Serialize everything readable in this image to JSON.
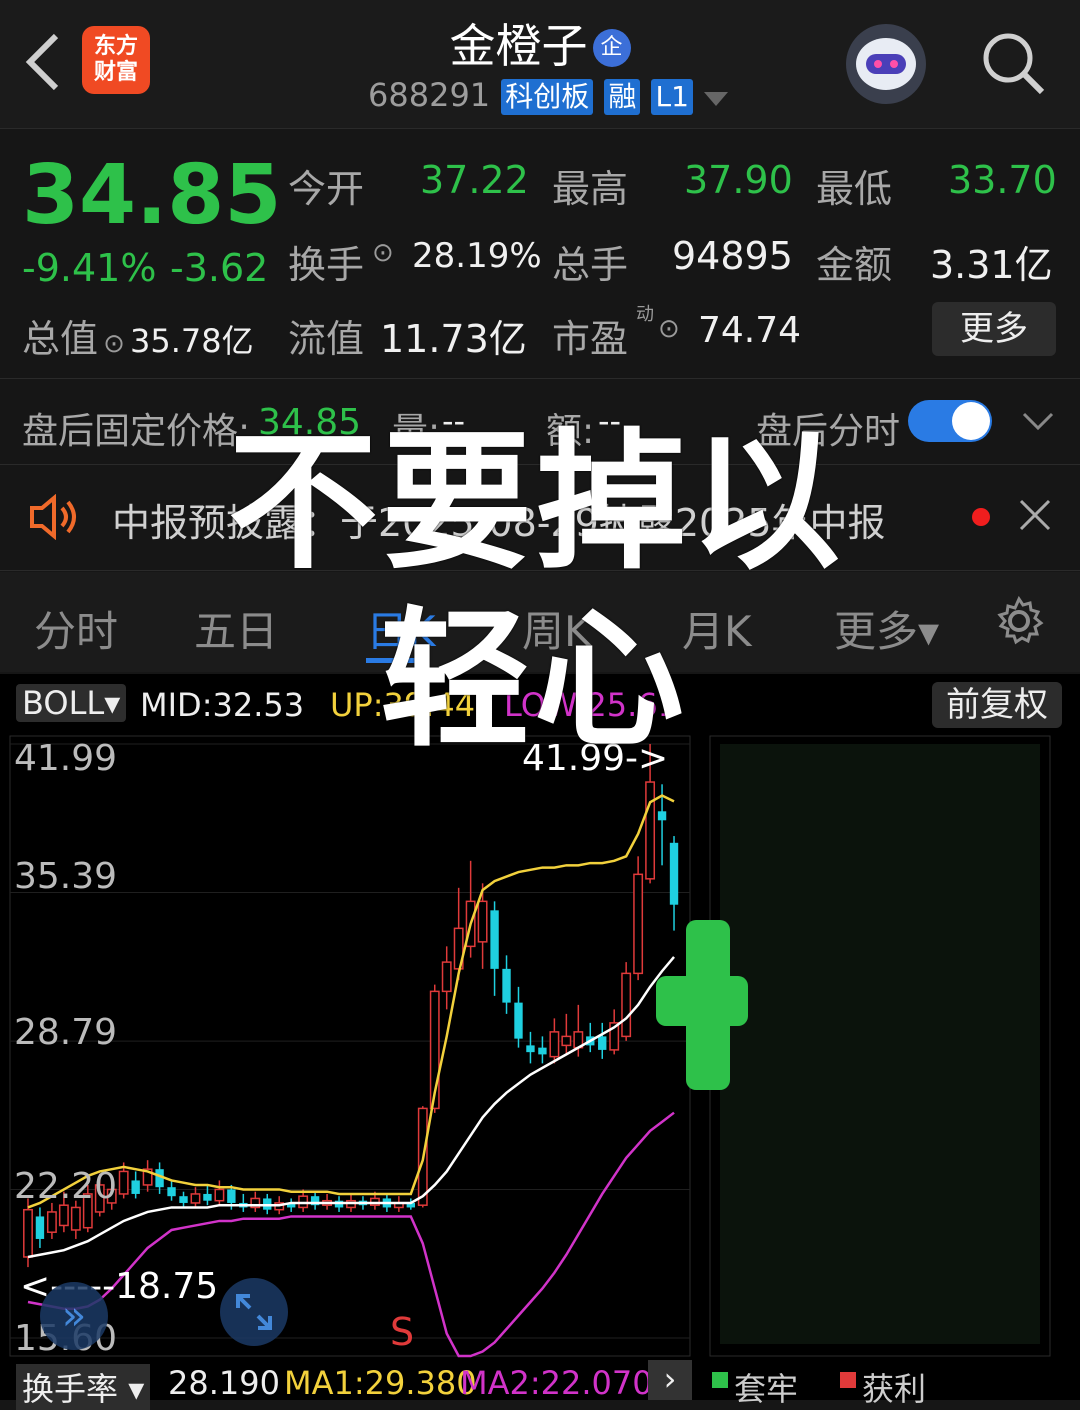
{
  "header": {
    "back_icon": "chevron-left-icon",
    "logo_text": "东方财富",
    "stock_name": "金橙子",
    "enterprise_badge": "企",
    "stock_code": "688291",
    "tags": [
      "科创板",
      "融",
      "L1"
    ],
    "search_icon": "search-icon"
  },
  "quote": {
    "price": "34.85",
    "change_pct": "-9.41%",
    "change_amt": "-3.62",
    "open_label": "今开",
    "open": "37.22",
    "high_label": "最高",
    "high": "37.90",
    "low_label": "最低",
    "low": "33.70",
    "turnover_label": "换手",
    "turnover": "28.19%",
    "volume_label": "总手",
    "volume": "94895",
    "amount_label": "金额",
    "amount": "3.31亿",
    "total_value_label": "总值",
    "total_value": "35.78亿",
    "float_value_label": "流值",
    "float_value": "11.73亿",
    "pe_label": "市盈",
    "pe_sup": "动",
    "pe": "74.74",
    "more_button": "更多"
  },
  "after_hours": {
    "label": "盘后固定价格:",
    "price": "34.85",
    "vol_label": "量:",
    "vol": "--",
    "amt_label": "额:",
    "amt": "--",
    "toggle_label": "盘后分时"
  },
  "notice": {
    "text": "中报预披露：于2025-08-29披露2025年中报"
  },
  "tabs": [
    "分时",
    "五日",
    "日K",
    "周K",
    "月K",
    "更多▾"
  ],
  "indicator": {
    "name": "BOLL▾",
    "mid": "MID:32.53",
    "up": "UP:39.44",
    "low": "LOW:25.61",
    "adjust": "前复权"
  },
  "chart_data": {
    "type": "candlestick",
    "y_tick_labels": [
      "41.99",
      "35.39",
      "28.79",
      "22.20",
      "15.60"
    ],
    "ylim": [
      15.6,
      41.99
    ],
    "high_marker": "41.99->",
    "low_marker": "<-----18.75",
    "signal_label": "S",
    "candles": [
      {
        "o": 19.2,
        "c": 21.3,
        "h": 21.8,
        "l": 18.75,
        "up": true
      },
      {
        "o": 20.0,
        "c": 21.0,
        "h": 21.4,
        "l": 19.6,
        "up": false
      },
      {
        "o": 20.3,
        "c": 21.2,
        "h": 21.6,
        "l": 20.0,
        "up": true
      },
      {
        "o": 20.6,
        "c": 21.5,
        "h": 22.1,
        "l": 20.3,
        "up": true
      },
      {
        "o": 20.4,
        "c": 21.4,
        "h": 21.7,
        "l": 20.0,
        "up": true
      },
      {
        "o": 20.5,
        "c": 22.0,
        "h": 22.4,
        "l": 20.3,
        "up": true
      },
      {
        "o": 21.2,
        "c": 22.4,
        "h": 22.9,
        "l": 21.0,
        "up": true
      },
      {
        "o": 21.6,
        "c": 22.2,
        "h": 22.6,
        "l": 21.3,
        "up": true
      },
      {
        "o": 22.0,
        "c": 23.0,
        "h": 23.4,
        "l": 21.8,
        "up": true
      },
      {
        "o": 22.6,
        "c": 22.0,
        "h": 23.0,
        "l": 21.8,
        "up": false
      },
      {
        "o": 22.4,
        "c": 23.1,
        "h": 23.5,
        "l": 22.1,
        "up": true
      },
      {
        "o": 23.1,
        "c": 22.3,
        "h": 23.4,
        "l": 22.0,
        "up": false
      },
      {
        "o": 22.3,
        "c": 21.9,
        "h": 22.6,
        "l": 21.7,
        "up": false
      },
      {
        "o": 21.9,
        "c": 21.6,
        "h": 22.1,
        "l": 21.4,
        "up": false
      },
      {
        "o": 21.6,
        "c": 22.0,
        "h": 22.3,
        "l": 21.4,
        "up": true
      },
      {
        "o": 22.0,
        "c": 21.7,
        "h": 22.4,
        "l": 21.5,
        "up": false
      },
      {
        "o": 21.7,
        "c": 22.2,
        "h": 22.6,
        "l": 21.5,
        "up": true
      },
      {
        "o": 22.2,
        "c": 21.6,
        "h": 22.4,
        "l": 21.3,
        "up": false
      },
      {
        "o": 21.6,
        "c": 21.4,
        "h": 22.0,
        "l": 21.2,
        "up": false
      },
      {
        "o": 21.4,
        "c": 21.8,
        "h": 22.1,
        "l": 21.2,
        "up": true
      },
      {
        "o": 21.8,
        "c": 21.3,
        "h": 22.0,
        "l": 21.1,
        "up": false
      },
      {
        "o": 21.3,
        "c": 21.6,
        "h": 21.9,
        "l": 21.1,
        "up": true
      },
      {
        "o": 21.6,
        "c": 21.4,
        "h": 21.8,
        "l": 21.2,
        "up": false
      },
      {
        "o": 21.4,
        "c": 21.9,
        "h": 22.2,
        "l": 21.2,
        "up": true
      },
      {
        "o": 21.9,
        "c": 21.5,
        "h": 22.1,
        "l": 21.3,
        "up": false
      },
      {
        "o": 21.5,
        "c": 21.7,
        "h": 22.0,
        "l": 21.3,
        "up": true
      },
      {
        "o": 21.7,
        "c": 21.4,
        "h": 21.9,
        "l": 21.2,
        "up": false
      },
      {
        "o": 21.4,
        "c": 21.7,
        "h": 22.0,
        "l": 21.2,
        "up": true
      },
      {
        "o": 21.7,
        "c": 21.5,
        "h": 21.9,
        "l": 21.3,
        "up": false
      },
      {
        "o": 21.5,
        "c": 21.8,
        "h": 22.1,
        "l": 21.3,
        "up": true
      },
      {
        "o": 21.8,
        "c": 21.4,
        "h": 22.0,
        "l": 21.2,
        "up": false
      },
      {
        "o": 21.4,
        "c": 21.6,
        "h": 21.9,
        "l": 21.2,
        "up": true
      },
      {
        "o": 21.6,
        "c": 21.4,
        "h": 21.8,
        "l": 21.3,
        "up": false
      },
      {
        "o": 21.5,
        "c": 25.8,
        "h": 25.9,
        "l": 21.4,
        "up": true
      },
      {
        "o": 25.8,
        "c": 31.0,
        "h": 31.3,
        "l": 25.6,
        "up": true
      },
      {
        "o": 31.0,
        "c": 32.3,
        "h": 33.0,
        "l": 30.2,
        "up": true
      },
      {
        "o": 32.0,
        "c": 33.8,
        "h": 35.6,
        "l": 31.5,
        "up": true
      },
      {
        "o": 33.0,
        "c": 35.0,
        "h": 36.8,
        "l": 32.5,
        "up": true
      },
      {
        "o": 35.0,
        "c": 33.2,
        "h": 35.8,
        "l": 32.0,
        "up": true
      },
      {
        "o": 34.6,
        "c": 32.0,
        "h": 35.0,
        "l": 30.8,
        "up": false
      },
      {
        "o": 32.0,
        "c": 30.5,
        "h": 32.6,
        "l": 30.0,
        "up": false
      },
      {
        "o": 30.5,
        "c": 28.9,
        "h": 31.2,
        "l": 28.5,
        "up": false
      },
      {
        "o": 28.6,
        "c": 28.3,
        "h": 29.2,
        "l": 27.8,
        "up": false
      },
      {
        "o": 28.5,
        "c": 28.2,
        "h": 29.0,
        "l": 27.8,
        "up": false
      },
      {
        "o": 28.1,
        "c": 29.2,
        "h": 29.8,
        "l": 27.8,
        "up": true
      },
      {
        "o": 28.6,
        "c": 29.0,
        "h": 30.0,
        "l": 28.2,
        "up": true
      },
      {
        "o": 28.5,
        "c": 29.2,
        "h": 30.4,
        "l": 28.1,
        "up": true
      },
      {
        "o": 29.0,
        "c": 28.6,
        "h": 29.6,
        "l": 28.3,
        "up": false
      },
      {
        "o": 28.4,
        "c": 29.0,
        "h": 29.6,
        "l": 28.0,
        "up": false
      },
      {
        "o": 28.4,
        "c": 29.6,
        "h": 30.2,
        "l": 28.2,
        "up": true
      },
      {
        "o": 29.0,
        "c": 31.8,
        "h": 32.3,
        "l": 28.8,
        "up": true
      },
      {
        "o": 31.8,
        "c": 36.2,
        "h": 37.0,
        "l": 31.5,
        "up": true
      },
      {
        "o": 36.0,
        "c": 40.3,
        "h": 41.99,
        "l": 35.8,
        "up": true
      },
      {
        "o": 38.6,
        "c": 39.0,
        "h": 40.2,
        "l": 36.6,
        "up": false
      },
      {
        "o": 37.6,
        "c": 34.85,
        "h": 37.9,
        "l": 33.7,
        "up": false
      }
    ],
    "boll_up": [
      21.4,
      21.6,
      21.9,
      22.2,
      22.5,
      22.8,
      23.0,
      23.1,
      23.2,
      23.1,
      23.0,
      22.8,
      22.6,
      22.5,
      22.4,
      22.4,
      22.3,
      22.3,
      22.2,
      22.2,
      22.2,
      22.2,
      22.1,
      22.1,
      22.1,
      22.1,
      22.0,
      22.0,
      22.0,
      22.0,
      22.0,
      22.0,
      22.0,
      23.5,
      26.5,
      29.0,
      31.8,
      34.0,
      35.5,
      35.9,
      36.1,
      36.3,
      36.4,
      36.5,
      36.5,
      36.6,
      36.6,
      36.7,
      36.7,
      36.8,
      37.0,
      38.0,
      39.4,
      39.7,
      39.44
    ],
    "boll_mid": [
      19.2,
      19.3,
      19.4,
      19.5,
      19.7,
      19.9,
      20.2,
      20.5,
      20.8,
      21.0,
      21.2,
      21.3,
      21.4,
      21.4,
      21.4,
      21.4,
      21.5,
      21.5,
      21.5,
      21.5,
      21.5,
      21.5,
      21.6,
      21.6,
      21.6,
      21.6,
      21.6,
      21.6,
      21.6,
      21.6,
      21.6,
      21.6,
      21.6,
      21.9,
      22.4,
      23.0,
      23.8,
      24.6,
      25.4,
      26.0,
      26.5,
      26.9,
      27.3,
      27.6,
      27.9,
      28.2,
      28.5,
      28.8,
      29.1,
      29.4,
      29.8,
      30.4,
      31.2,
      31.9,
      32.53
    ],
    "boll_low": [
      17.2,
      17.1,
      17.0,
      16.9,
      16.9,
      17.0,
      17.3,
      17.8,
      18.4,
      19.0,
      19.6,
      20.0,
      20.4,
      20.5,
      20.6,
      20.7,
      20.8,
      20.8,
      20.9,
      20.9,
      20.9,
      20.9,
      21.0,
      21.0,
      21.0,
      21.0,
      21.0,
      21.0,
      21.0,
      21.0,
      21.0,
      21.0,
      21.0,
      19.8,
      17.8,
      15.8,
      14.8,
      14.8,
      15.0,
      15.4,
      16.0,
      16.6,
      17.2,
      17.8,
      18.5,
      19.3,
      20.2,
      21.1,
      22.0,
      22.8,
      23.6,
      24.2,
      24.8,
      25.2,
      25.61
    ]
  },
  "overlay_text": [
    "不要掉以",
    "轻心"
  ],
  "bottom_bar": {
    "indicator": "换手率",
    "value": "28.190",
    "ma1": "MA1:29.380",
    "ma2": "MA2:22.070",
    "legend_trapped": "套牢",
    "legend_profit": "获利"
  },
  "colors": {
    "up": "#e03a3a",
    "down": "#1fd0e0",
    "green": "#2ec14a",
    "boll_up": "#f2d13c",
    "boll_mid": "#ffffff",
    "boll_low": "#d133c9",
    "accent_blue": "#2a7be4"
  }
}
